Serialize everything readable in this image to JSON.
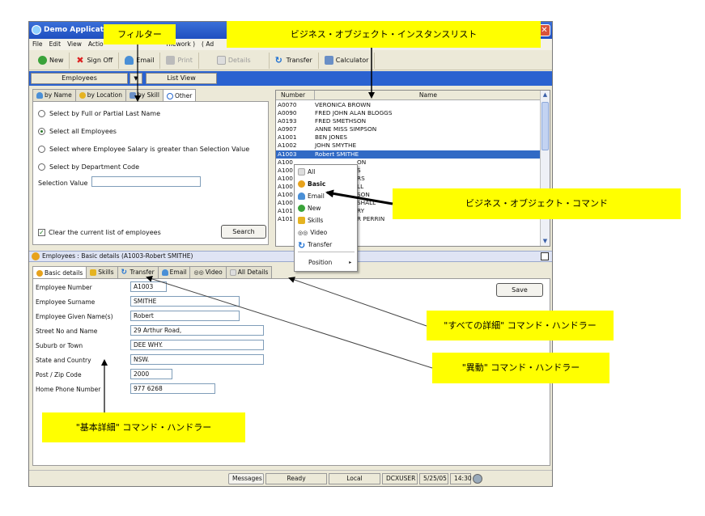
{
  "window": {
    "title": "Demo Application",
    "close": "✕"
  },
  "menu": [
    "File",
    "Edit",
    "View",
    "Actio",
    "mework )",
    "( Ad"
  ],
  "toolbar": {
    "new": "New",
    "signoff": "Sign Off",
    "email": "Email",
    "print": "Print",
    "details": "Details",
    "transfer": "Transfer",
    "calculator": "Calculator"
  },
  "selector": {
    "object": "Employees",
    "arrow": "▼",
    "view": "List View"
  },
  "filter_tabs": [
    "by Name",
    "by Location",
    "by Skill",
    "Other"
  ],
  "filter": {
    "options": [
      "Select by Full or Partial Last Name",
      "Select all Employees",
      "Select where Employee Salary is greater than Selection Value",
      "Select by Department Code"
    ],
    "selection_label": "Selection Value",
    "clear_label": "Clear the current list of employees",
    "search": "Search"
  },
  "list": {
    "headers": [
      "Number",
      "Name"
    ],
    "rows": [
      [
        "A0070",
        "VERONICA BROWN"
      ],
      [
        "A0090",
        "FRED JOHN ALAN BLOGGS"
      ],
      [
        "A0193",
        "FRED SMETHSON"
      ],
      [
        "A0907",
        "ANNE MISS SIMPSON"
      ],
      [
        "A1001",
        "BEN JONES"
      ],
      [
        "A1002",
        "JOHN SMYTHE"
      ],
      [
        "A1003",
        "Robert SMITHE"
      ],
      [
        "A100",
        "ON"
      ],
      [
        "A100",
        "S"
      ],
      [
        "A100",
        "RS"
      ],
      [
        "A100",
        "LL"
      ],
      [
        "A100",
        "SON"
      ],
      [
        "A100",
        "SHALL"
      ],
      [
        "A101",
        "RY"
      ],
      [
        "A101",
        "R PERRIN"
      ]
    ]
  },
  "context_menu": {
    "items": [
      "All",
      "Basic",
      "Email",
      "New",
      "Skills",
      "Video",
      "Transfer"
    ],
    "position": "Position",
    "submenu": "▸"
  },
  "detail_bar": {
    "title": "Employees : Basic details (A1003-Robert SMITHE)"
  },
  "detail_tabs": [
    "Basic details",
    "Skills",
    "Transfer",
    "Email",
    "Video",
    "All Details"
  ],
  "fields": [
    {
      "label": "Employee Number",
      "value": "A1003"
    },
    {
      "label": "Employee Surname",
      "value": "SMITHE"
    },
    {
      "label": "Employee Given Name(s)",
      "value": "Robert"
    },
    {
      "label": "Street No and Name",
      "value": "29 Arthur Road,"
    },
    {
      "label": "Suburb or Town",
      "value": "DEE WHY."
    },
    {
      "label": "State and Country",
      "value": "NSW."
    },
    {
      "label": "Post / Zip Code",
      "value": "2000"
    },
    {
      "label": "Home Phone Number",
      "value": "977 6268"
    }
  ],
  "save": "Save",
  "status": {
    "messages": "Messages",
    "ready": "Ready",
    "local": "Local",
    "user": "DCXUSER",
    "date": "5/25/05",
    "time": "14:30"
  },
  "callouts": {
    "filter": "フィルター",
    "list": "ビジネス・オブジェクト・インスタンスリスト",
    "command": "ビジネス・オブジェクト・コマンド",
    "all_details": "\"すべての詳細\" コマンド・ハンドラー",
    "transfer": "\"異動\" コマンド・ハンドラー",
    "basic": "\"基本詳細\" コマンド・ハンドラー"
  },
  "colors": {
    "callout": "#ffff00",
    "titlebar": "#1f4fc0",
    "selection": "#316ac5"
  }
}
